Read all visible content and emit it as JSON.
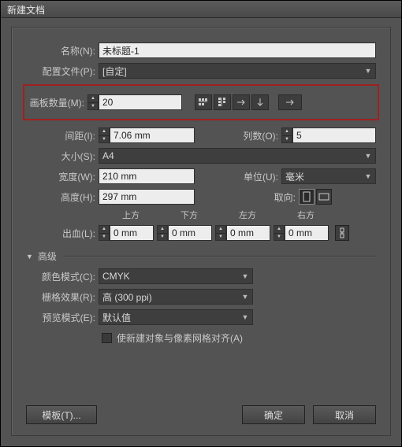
{
  "title": "新建文档",
  "name": {
    "label": "名称(N):",
    "value": "未标题-1"
  },
  "profile": {
    "label": "配置文件(P):",
    "value": "[自定]"
  },
  "artboards": {
    "label": "画板数量(M):",
    "value": "20"
  },
  "spacing": {
    "label": "间距(I):",
    "value": "7.06 mm"
  },
  "columns": {
    "label": "列数(O):",
    "value": "5"
  },
  "size": {
    "label": "大小(S):",
    "value": "A4"
  },
  "width": {
    "label": "宽度(W):",
    "value": "210 mm"
  },
  "units": {
    "label": "单位(U):",
    "value": "毫米"
  },
  "height": {
    "label": "高度(H):",
    "value": "297 mm"
  },
  "orient": {
    "label": "取向:"
  },
  "bleed": {
    "label": "出血(L):",
    "top": {
      "label": "上方",
      "value": "0 mm"
    },
    "bottom": {
      "label": "下方",
      "value": "0 mm"
    },
    "left": {
      "label": "左方",
      "value": "0 mm"
    },
    "right": {
      "label": "右方",
      "value": "0 mm"
    }
  },
  "advanced": "高级",
  "colorMode": {
    "label": "颜色模式(C):",
    "value": "CMYK"
  },
  "raster": {
    "label": "栅格效果(R):",
    "value": "高 (300 ppi)"
  },
  "preview": {
    "label": "预览模式(E):",
    "value": "默认值"
  },
  "align": "使新建对象与像素网格对齐(A)",
  "template": "模板(T)...",
  "ok": "确定",
  "cancel": "取消"
}
